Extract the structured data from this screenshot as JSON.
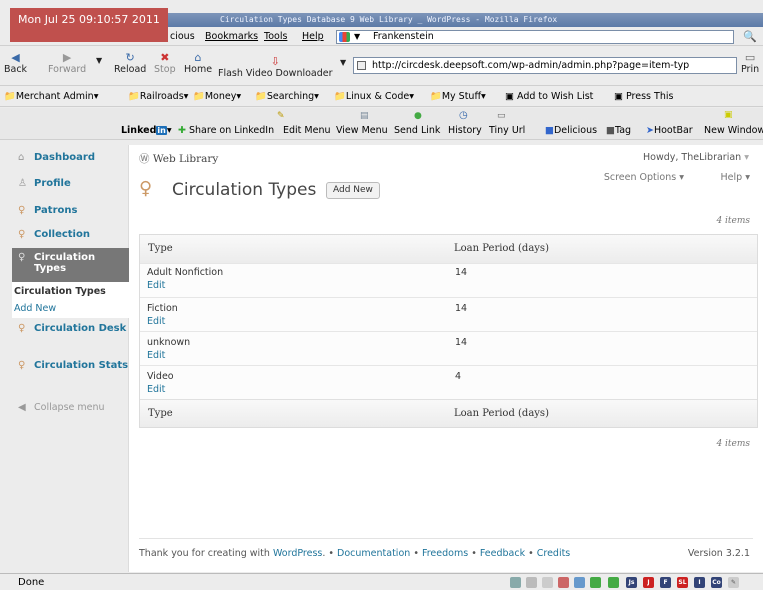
{
  "clock": "Mon Jul 25 09:10:57 2011",
  "window_title": "Circulation Types Database  9 Web Library  _ WordPress - Mozilla Firefox",
  "menu": {
    "items": [
      "cious",
      "Bookmarks",
      "Tools",
      "Help"
    ],
    "search_value": "Frankenstein"
  },
  "nav": {
    "back": "Back",
    "forward": "Forward",
    "reload": "Reload",
    "stop": "Stop",
    "home": "Home",
    "flash": "Flash Video Downloader",
    "url": "http://circdesk.deepsoft.com/wp-admin/admin.php?page=item-typ",
    "print": "Prin"
  },
  "bookmarks": [
    "Merchant Admin▾",
    "Railroads▾",
    "Money▾",
    "Searching▾",
    "Linux & Code▾",
    "My Stuff▾",
    "Add to Wish List",
    "Press This"
  ],
  "linkedin_bar": {
    "linkedin": "Linked",
    "share": "Share on LinkedIn",
    "edit_menu": "Edit Menu",
    "view_menu": "View Menu",
    "send_link": "Send Link",
    "history": "History",
    "tiny_url": "Tiny Url",
    "delicious": "Delicious",
    "tag": "Tag",
    "hootbar": "HootBar",
    "new_window": "New Window"
  },
  "sidebar": {
    "items": [
      {
        "label": "Dashboard"
      },
      {
        "label": "Profile"
      },
      {
        "label": "Patrons"
      },
      {
        "label": "Collection"
      },
      {
        "label": "Circulation Types"
      },
      {
        "label": "Circulation Desk"
      },
      {
        "label": "Circulation Stats"
      }
    ],
    "sub": [
      "Circulation Types",
      "Add New"
    ],
    "collapse": "Collapse menu"
  },
  "wp": {
    "site": "Web Library",
    "howdy": "Howdy, TheLibrarian",
    "title": "Circulation Types",
    "add_new": "Add New",
    "screen_options": "Screen Options",
    "help": "Help",
    "count_top": "4 items",
    "count_bottom": "4 items",
    "columns": [
      "Type",
      "Loan Period (days)"
    ],
    "rows": [
      {
        "type": "Adult Nonfiction",
        "loan": "14",
        "action": "Edit"
      },
      {
        "type": "Fiction",
        "loan": "14",
        "action": "Edit"
      },
      {
        "type": "unknown",
        "loan": "14",
        "action": "Edit"
      },
      {
        "type": "Video",
        "loan": "4",
        "action": "Edit"
      }
    ],
    "footer": {
      "thanks": "Thank you for creating with",
      "wordpress": "WordPress",
      "links": [
        "Documentation",
        "Freedoms",
        "Feedback",
        "Credits"
      ],
      "version": "Version 3.2.1"
    }
  },
  "status": "Done",
  "status_icons": [
    "Js",
    "J",
    "F",
    "SL",
    "I",
    "Co"
  ],
  "colors": {
    "link": "#21759b",
    "clock_bg": "#c0504d",
    "current_menu": "#777777"
  }
}
